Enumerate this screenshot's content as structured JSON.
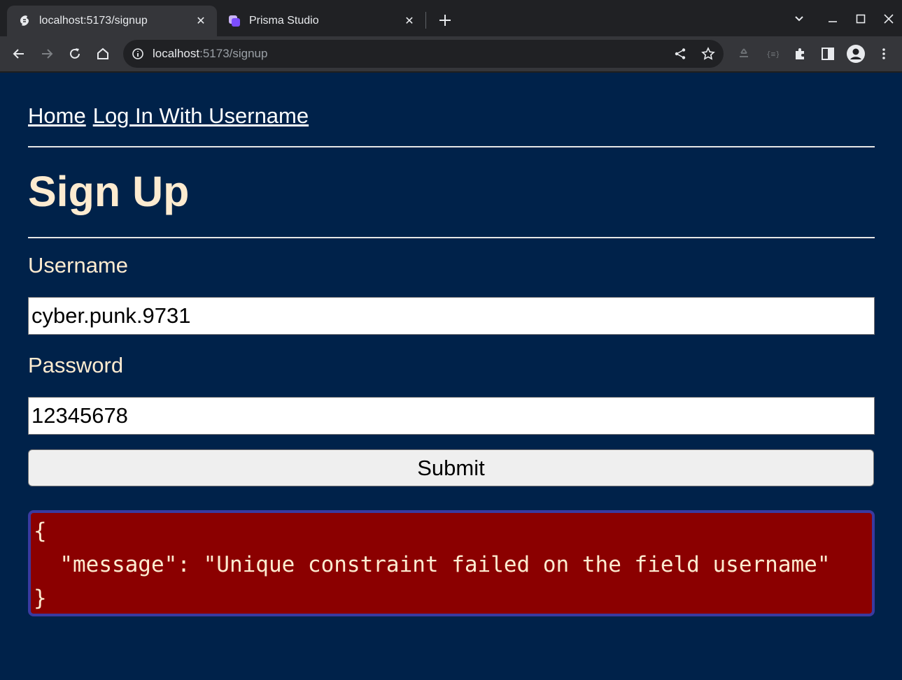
{
  "browser": {
    "tabs": [
      {
        "title": "localhost:5173/signup",
        "active": true,
        "favicon": "svelte-icon"
      },
      {
        "title": "Prisma Studio",
        "active": false,
        "favicon": "prisma-icon"
      }
    ],
    "url": {
      "host": "localhost",
      "rest": ":5173/signup"
    }
  },
  "nav": {
    "links": [
      "Home",
      "Log In With Username"
    ]
  },
  "page": {
    "title": "Sign Up",
    "username_label": "Username",
    "username_value": "cyber.punk.9731",
    "password_label": "Password",
    "password_value": "12345678",
    "submit_label": "Submit"
  },
  "error": {
    "line1": "{",
    "line2": "  \"message\": \"Unique constraint failed on the field username\"",
    "line3": "}"
  },
  "colors": {
    "page_background": "#00224a",
    "heading": "#fdebd0",
    "error_background": "#8b0000",
    "error_border": "#3a3aa0"
  }
}
